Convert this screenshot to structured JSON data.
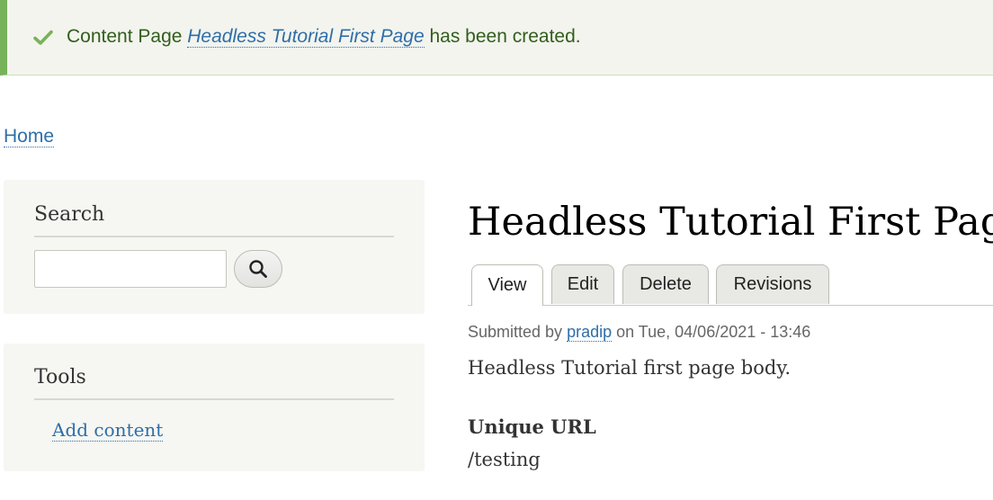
{
  "status_message": {
    "prefix": "Content Page ",
    "link_text": "Headless Tutorial First Page",
    "suffix": " has been created.",
    "icon": "check-icon",
    "color": "#77b259"
  },
  "breadcrumb": {
    "home": "Home"
  },
  "sidebar": {
    "search": {
      "title": "Search",
      "input_value": "",
      "button_icon": "search-icon"
    },
    "tools": {
      "title": "Tools",
      "items": [
        "Add content"
      ]
    }
  },
  "main": {
    "title": "Headless Tutorial First Page",
    "tabs": [
      {
        "label": "View",
        "active": true
      },
      {
        "label": "Edit",
        "active": false
      },
      {
        "label": "Delete",
        "active": false
      },
      {
        "label": "Revisions",
        "active": false
      }
    ],
    "submitted": {
      "prefix": "Submitted by ",
      "author": "pradip",
      "suffix": " on Tue, 04/06/2021 - 13:46"
    },
    "body": "Headless Tutorial first page body.",
    "field": {
      "label": "Unique URL",
      "value": "/testing"
    }
  },
  "colors": {
    "link": "#2e6ea8",
    "status_bg": "#f3f4ee",
    "status_text": "#325e1c",
    "sidebar_bg": "#f6f6f2"
  }
}
